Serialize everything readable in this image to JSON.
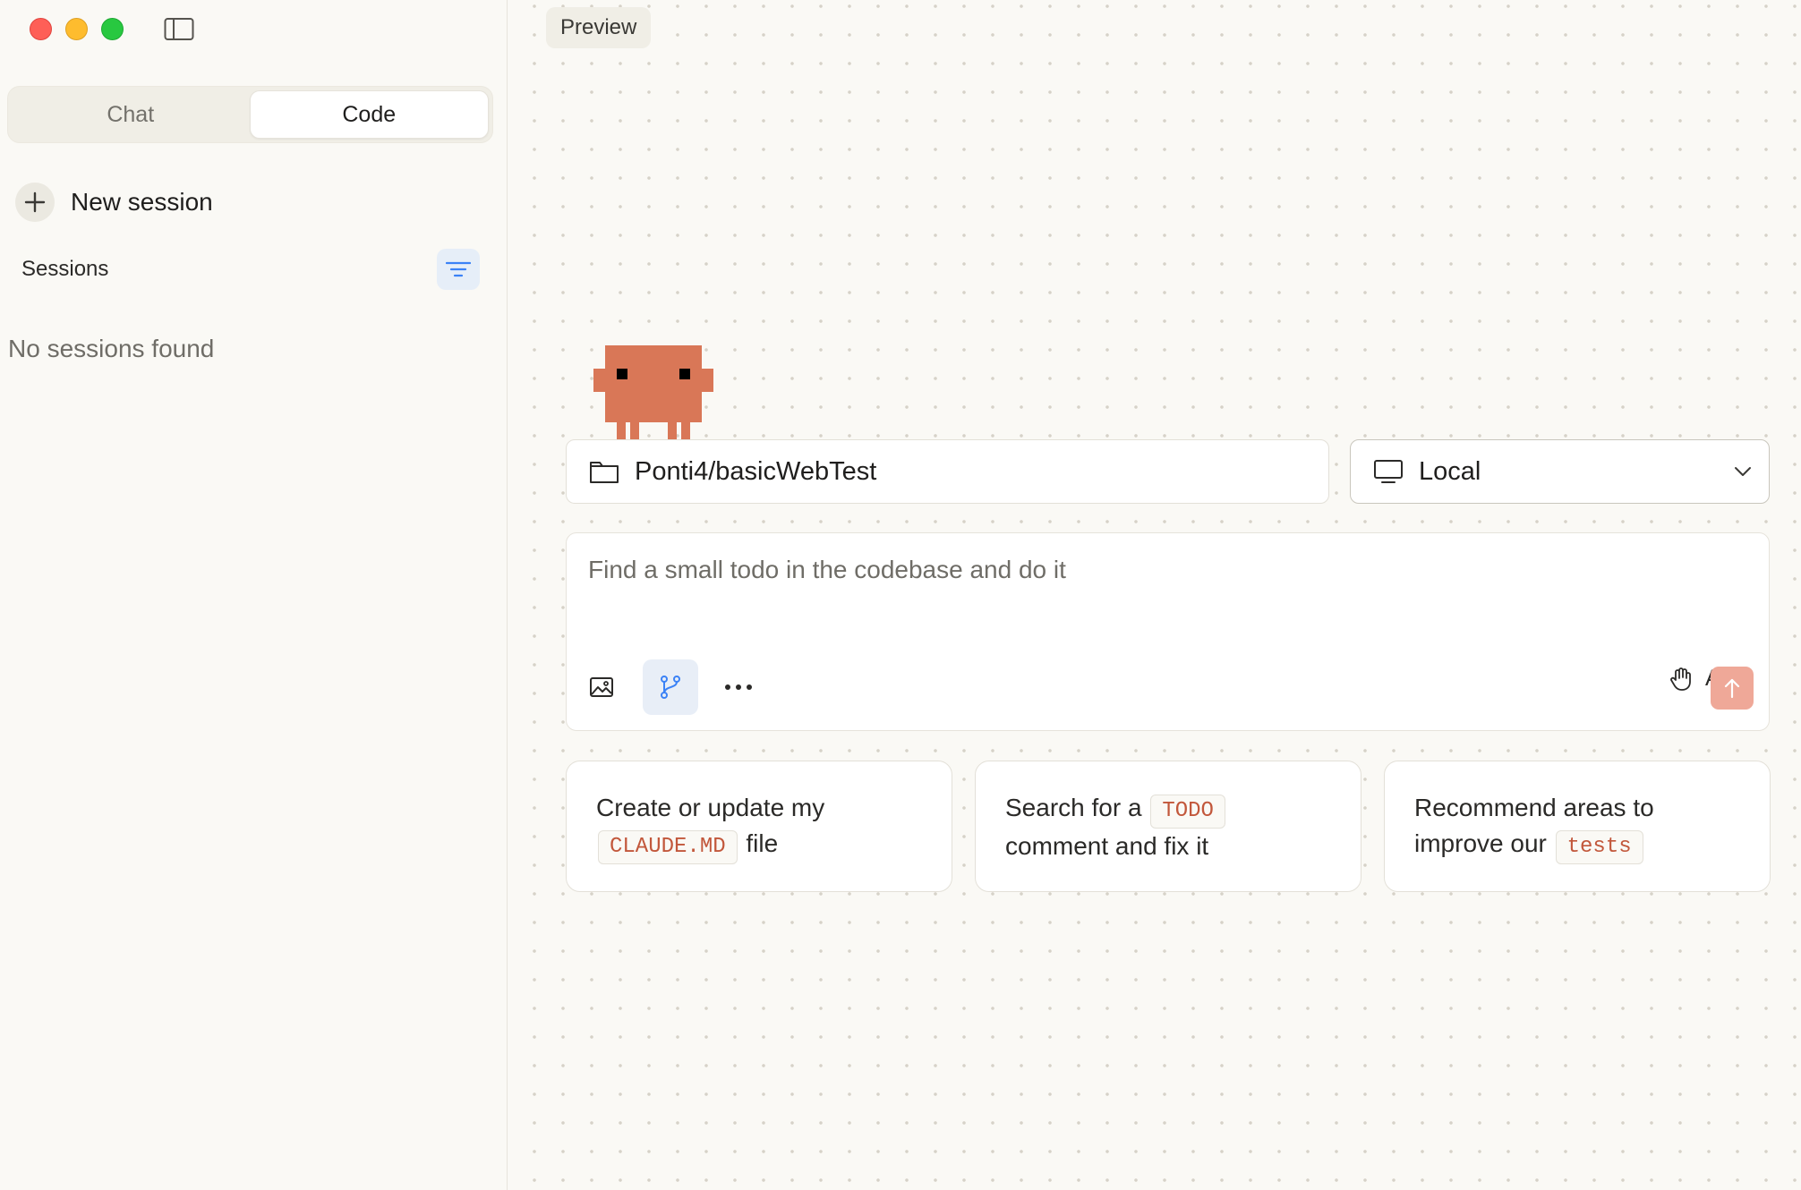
{
  "sidebar": {
    "tabs": [
      {
        "label": "Chat",
        "active": false
      },
      {
        "label": "Code",
        "active": true
      }
    ],
    "new_session_label": "New session",
    "sessions_title": "Sessions",
    "empty_text": "No sessions found"
  },
  "main": {
    "preview_label": "Preview",
    "repo": {
      "label": "Ponti4/basicWebTest",
      "icon": "folder-icon"
    },
    "environment": {
      "label": "Local",
      "icon": "monitor-icon"
    },
    "composer": {
      "placeholder": "Find a small todo in the codebase and do it",
      "ask_label": "Ask"
    },
    "suggestions": [
      {
        "text_before": "Create or update my",
        "code": "CLAUDE.MD",
        "text_after": "file"
      },
      {
        "text_before": "Search for a",
        "code": "TODO",
        "text_after": "comment and fix it"
      },
      {
        "text_before": "Recommend areas to improve our",
        "code": "tests",
        "text_after": ""
      }
    ]
  },
  "colors": {
    "accent": "#d97757",
    "send_button": "#efa898",
    "code_text": "#c2573b",
    "background": "#faf9f5",
    "filter_icon": "#3b82f6"
  }
}
